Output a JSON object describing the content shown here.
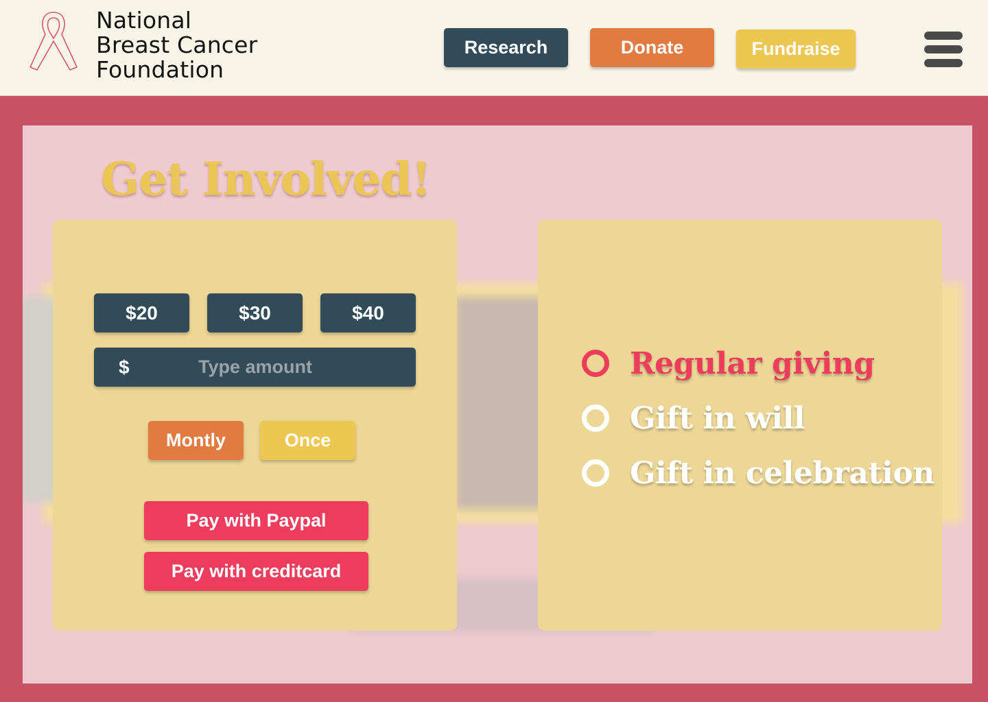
{
  "header": {
    "org_name": [
      "National",
      "Breast Cancer",
      "Foundation"
    ],
    "logo_icon": "pink-ribbon-icon",
    "nav": {
      "research": "Research",
      "donate": "Donate",
      "fundraise": "Fundraise"
    },
    "menu_icon": "hamburger-menu-icon"
  },
  "main": {
    "heading": "Get Involved!",
    "amounts": [
      "$20",
      "$30",
      "$40"
    ],
    "custom_amount": {
      "currency_symbol": "$",
      "value": "",
      "placeholder": "Type amount"
    },
    "frequency": {
      "monthly": "Montly",
      "once": "Once"
    },
    "payment": {
      "paypal": "Pay with Paypal",
      "creditcard": "Pay with creditcard"
    },
    "giving_options": [
      {
        "label": "Regular giving",
        "selected": true
      },
      {
        "label": "Gift in will",
        "selected": false
      },
      {
        "label": "Gift in celebration",
        "selected": false
      }
    ]
  },
  "colors": {
    "page_background": "#c95364",
    "header_background": "#f8f5e8",
    "panel_background": "#eecbd0",
    "card_background": "#ecd796",
    "navy": "#324b59",
    "orange": "#e27b42",
    "yellow": "#edc752",
    "pink_accent": "#ee3c5d"
  }
}
